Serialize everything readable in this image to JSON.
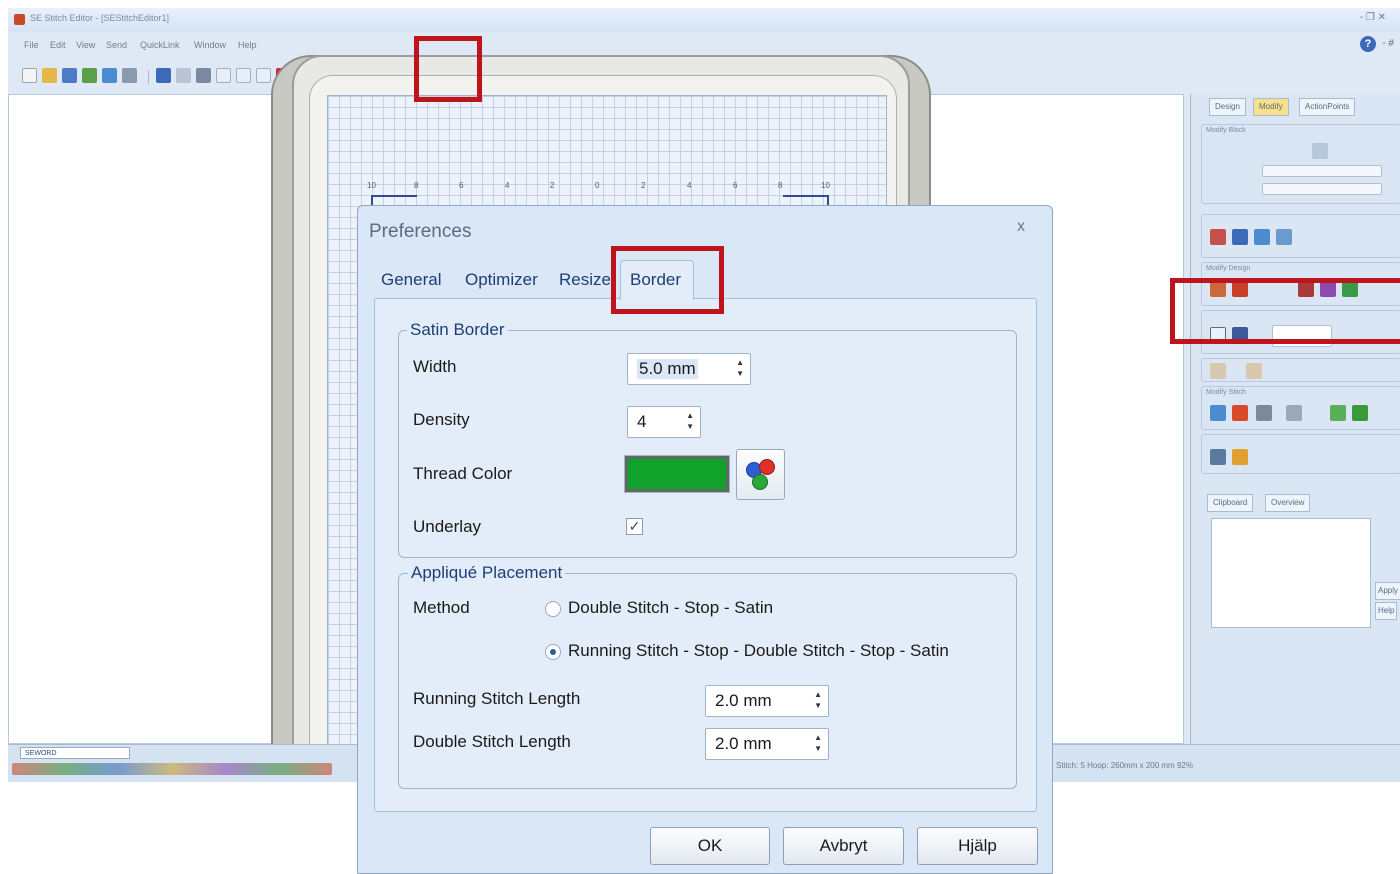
{
  "window": {
    "title": "SE Stitch Editor - [SEStitchEditor1]",
    "controls": "- ❐ ✕"
  },
  "menu": [
    "File",
    "Edit",
    "View",
    "Send",
    "QuickLink",
    "Window",
    "Help"
  ],
  "help_icon": "?",
  "help_extra": "- #",
  "side_panel": {
    "tabs": [
      "Design",
      "Modify",
      "ActionPoints"
    ],
    "groups": [
      "Modify Block",
      "Modify Design",
      "Modify Stitch"
    ],
    "clipboard_tabs": [
      "Clipboard",
      "Overview"
    ],
    "side_buttons": [
      "Apply",
      "Help"
    ]
  },
  "bottom": {
    "task_tab": "SEWORD",
    "status": "Stitch: 5    Hoop: 260mm x 200 mm    92%"
  },
  "ruler": [
    "10",
    "8",
    "6",
    "4",
    "2",
    "0",
    "2",
    "4",
    "6",
    "8",
    "10"
  ],
  "dialog": {
    "title": "Preferences",
    "close_glyph": "x",
    "tabs": [
      "General",
      "Optimizer",
      "Resize",
      "Border"
    ],
    "active_tab": "Border",
    "satin": {
      "legend": "Satin Border",
      "width_label": "Width",
      "width_value": "5.0 mm",
      "density_label": "Density",
      "density_value": "4",
      "thread_label": "Thread Color",
      "thread_color": "#11a22b",
      "underlay_label": "Underlay",
      "underlay_checked": true
    },
    "applique": {
      "legend": "Appliqué Placement",
      "method_label": "Method",
      "options": [
        "Double Stitch - Stop - Satin",
        "Running Stitch - Stop - Double Stitch - Stop - Satin"
      ],
      "selected_option": 1,
      "running_label": "Running Stitch Length",
      "running_value": "2.0 mm",
      "double_label": "Double Stitch Length",
      "double_value": "2.0 mm"
    },
    "buttons": {
      "ok": "OK",
      "cancel": "Avbryt",
      "help": "Hjälp"
    }
  }
}
